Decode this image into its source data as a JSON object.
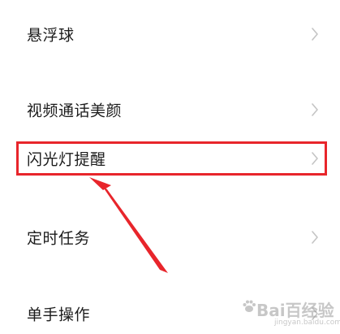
{
  "settings": {
    "items": [
      {
        "label": "悬浮球"
      },
      {
        "label": "视频通话美颜"
      },
      {
        "label": "闪光灯提醒"
      },
      {
        "label": "定时任务"
      },
      {
        "label": "单手操作"
      }
    ]
  },
  "watermark": {
    "text": "Bai百经验",
    "sub": "jingyan.baidu.com"
  },
  "colors": {
    "annotation": "#e8252b",
    "text": "#1c1c1c",
    "chevron": "#c4c4c4"
  }
}
